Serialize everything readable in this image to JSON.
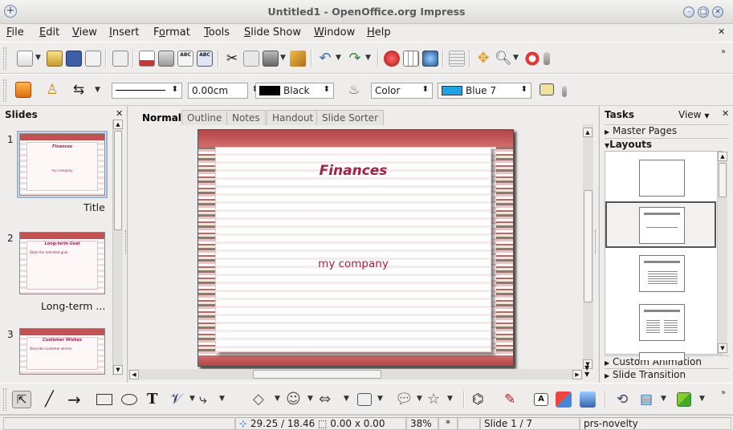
{
  "window": {
    "title": "Untitled1 - OpenOffice.org Impress"
  },
  "menus": [
    {
      "label": "File",
      "u": "F"
    },
    {
      "label": "Edit",
      "u": "E"
    },
    {
      "label": "View",
      "u": "V"
    },
    {
      "label": "Insert",
      "u": "I"
    },
    {
      "label": "Format",
      "u": "o"
    },
    {
      "label": "Tools",
      "u": "T"
    },
    {
      "label": "Slide Show",
      "u": "S"
    },
    {
      "label": "Window",
      "u": "W"
    },
    {
      "label": "Help",
      "u": "H"
    }
  ],
  "line_toolbar": {
    "line_width": "0.00cm",
    "line_color": "Black",
    "line_color_hex": "#000000",
    "area_style": "Color",
    "area_color": "Blue 7",
    "area_color_hex": "#1ea3e8"
  },
  "slides_pane": {
    "header": "Slides",
    "slides": [
      {
        "number": "1",
        "caption": "Title",
        "title": "Finances",
        "body": "my company"
      },
      {
        "number": "2",
        "caption": "Long-term ...",
        "title": "Long-term Goal",
        "body": "State the intended goal"
      },
      {
        "number": "3",
        "caption": "",
        "title": "Customer Wishes",
        "body": "Describe customer wishes"
      }
    ]
  },
  "view_tabs": [
    "Normal",
    "Outline",
    "Notes",
    "Handout",
    "Slide Sorter"
  ],
  "active_tab": "Normal",
  "slide": {
    "title": "Finances",
    "subtitle": "my company",
    "accent": "#a3224b"
  },
  "tasks_pane": {
    "header": "Tasks",
    "view_label": "View",
    "sections": {
      "master_pages": "Master Pages",
      "layouts": "Layouts",
      "custom_animation": "Custom Animation",
      "slide_transition": "Slide Transition"
    }
  },
  "status": {
    "position": "29.25 / 18.46",
    "size": "0.00 x 0.00",
    "zoom": "38%",
    "modified": "*",
    "slide": "Slide 1 / 7",
    "master": "prs-novelty"
  }
}
